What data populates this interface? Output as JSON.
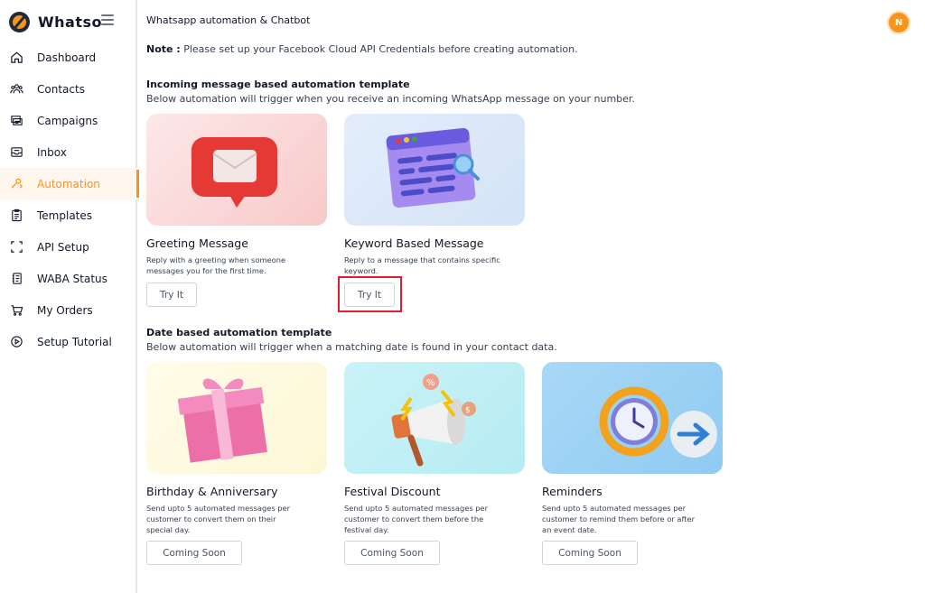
{
  "brand": {
    "name": "Whatso"
  },
  "sidebar": {
    "items": [
      {
        "label": "Dashboard",
        "icon": "home-icon"
      },
      {
        "label": "Contacts",
        "icon": "contacts-icon"
      },
      {
        "label": "Campaigns",
        "icon": "campaigns-icon"
      },
      {
        "label": "Inbox",
        "icon": "inbox-icon"
      },
      {
        "label": "Automation",
        "icon": "automation-icon",
        "active": true
      },
      {
        "label": "Templates",
        "icon": "templates-icon"
      },
      {
        "label": "API Setup",
        "icon": "api-setup-icon"
      },
      {
        "label": "WABA Status",
        "icon": "waba-status-icon"
      },
      {
        "label": "My Orders",
        "icon": "cart-icon"
      },
      {
        "label": "Setup Tutorial",
        "icon": "play-icon"
      }
    ]
  },
  "header": {
    "title": "Whatsapp automation & Chatbot",
    "avatar_initial": "N"
  },
  "note": {
    "label": "Note :",
    "text": " Please set up your Facebook Cloud API Credentials before creating automation."
  },
  "incoming": {
    "title": "Incoming message based automation template",
    "subtitle": "Below automation will trigger when you receive an incoming WhatsApp message on your number.",
    "cards": [
      {
        "title": "Greeting Message",
        "desc": "Reply with a greeting when someone messages you for the first time.",
        "button": "Try It"
      },
      {
        "title": "Keyword Based Message",
        "desc": "Reply to a message that contains specific keyword.",
        "button": "Try It"
      }
    ]
  },
  "date": {
    "title": "Date based automation template",
    "subtitle": "Below automation will trigger when a matching date is found in your contact data.",
    "cards": [
      {
        "title": "Birthday & Anniversary",
        "desc": "Send upto 5 automated messages per customer to convert them on their special day.",
        "button": "Coming Soon"
      },
      {
        "title": "Festival Discount",
        "desc": "Send upto 5 automated messages per customer to convert them before the festival day.",
        "button": "Coming Soon"
      },
      {
        "title": "Reminders",
        "desc": "Send upto 5 automated messages per customer to remind them before or after an event date.",
        "button": "Coming Soon"
      }
    ]
  },
  "colors": {
    "accent": "#f7941d",
    "highlight": "#e11d2e",
    "text": "#111827"
  }
}
